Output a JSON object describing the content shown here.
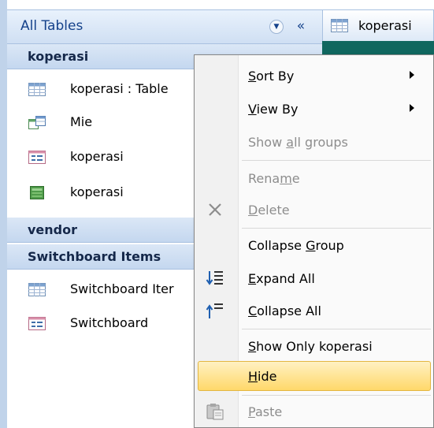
{
  "nav": {
    "title": "All Tables",
    "dropdown_glyph": "▼",
    "shutter_glyph": "«",
    "groups": [
      {
        "name": "koperasi",
        "items": [
          {
            "label": "koperasi : Table",
            "icon": "table-icon"
          },
          {
            "label": "Mie",
            "icon": "query-icon"
          },
          {
            "label": "koperasi",
            "icon": "form-icon"
          },
          {
            "label": "koperasi",
            "icon": "report-icon"
          }
        ]
      },
      {
        "name": "vendor",
        "items": []
      },
      {
        "name": "Switchboard Items",
        "items": [
          {
            "label": "Switchboard Iter",
            "icon": "table-icon"
          },
          {
            "label": "Switchboard",
            "icon": "form-icon"
          }
        ]
      }
    ]
  },
  "doc_tab": {
    "label": "koperasi",
    "icon": "table-icon"
  },
  "context_menu": {
    "items": [
      {
        "pre": "",
        "key": "S",
        "post": "ort By",
        "submenu": true,
        "disabled": false
      },
      {
        "pre": "",
        "key": "V",
        "post": "iew By",
        "submenu": true,
        "disabled": false
      },
      {
        "pre": "Show ",
        "key": "a",
        "post": "ll groups",
        "disabled": true
      },
      {
        "pre": "Rena",
        "key": "m",
        "post": "e",
        "disabled": true
      },
      {
        "pre": "",
        "key": "D",
        "post": "elete",
        "disabled": true,
        "icon": "delete-x-icon"
      },
      {
        "pre": "Collapse ",
        "key": "G",
        "post": "roup",
        "disabled": false
      },
      {
        "pre": "",
        "key": "E",
        "post": "xpand All",
        "disabled": false,
        "icon": "expand-all-icon"
      },
      {
        "pre": "",
        "key": "C",
        "post": "ollapse All",
        "disabled": false,
        "icon": "collapse-all-icon"
      },
      {
        "pre": "",
        "key": "S",
        "post": "how Only koperasi",
        "disabled": false
      },
      {
        "pre": "",
        "key": "H",
        "post": "ide",
        "disabled": false,
        "highlight": true
      },
      {
        "pre": "",
        "key": "P",
        "post": "aste",
        "disabled": true,
        "icon": "paste-icon"
      }
    ]
  },
  "colors": {
    "pane_border": "#c0d3ea",
    "header_text": "#15428b",
    "highlight": "#ffd86a",
    "doc_strip": "#10675f"
  }
}
